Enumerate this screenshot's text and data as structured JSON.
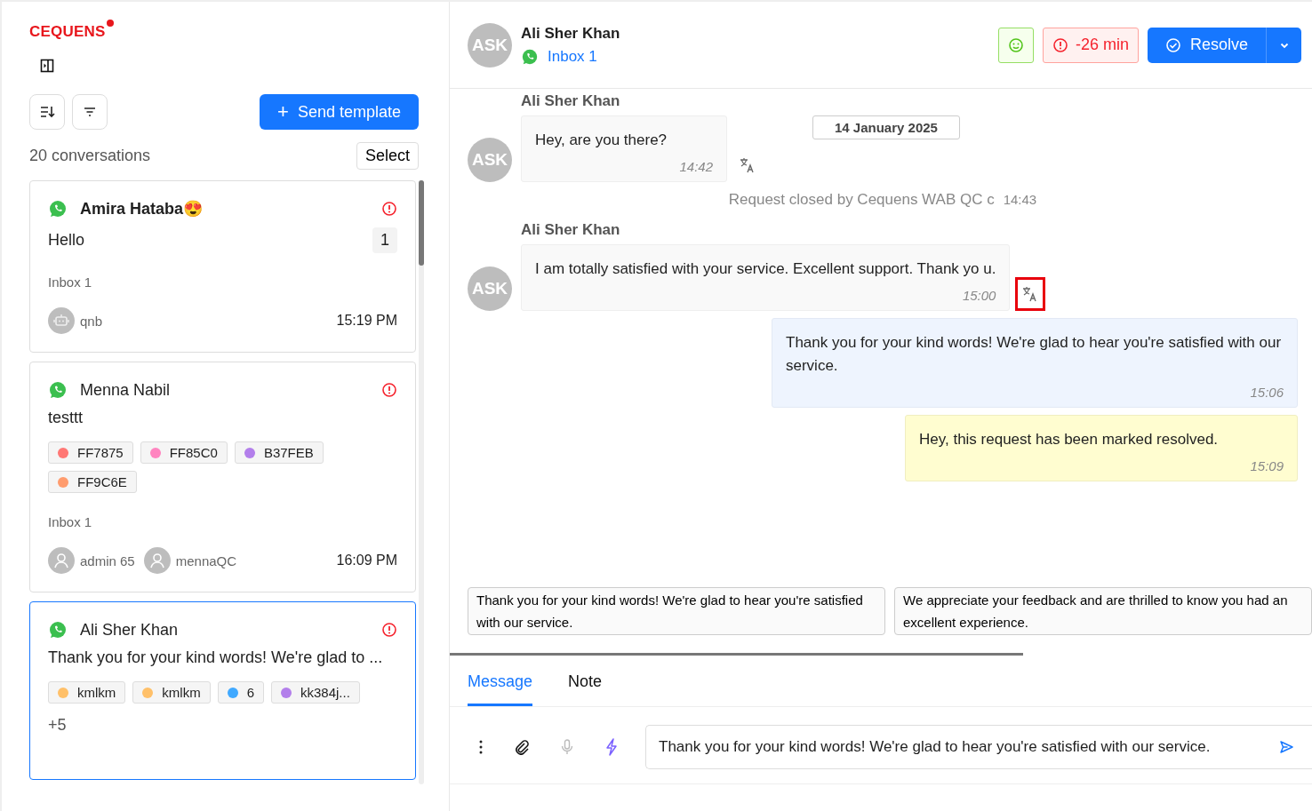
{
  "brand": {
    "logo": "CEQUENS"
  },
  "sidebar": {
    "send_template_icon": "+",
    "send_template": "Send template",
    "count": "20 conversations",
    "select": "Select",
    "conversations": [
      {
        "name": "Amira Hataba😍",
        "preview": "Hello",
        "unread": "1",
        "inbox": "Inbox 1",
        "agents": [
          {
            "name": "qnb",
            "kind": "bot"
          }
        ],
        "time": "15:19 PM",
        "selected": false
      },
      {
        "name": "Menna Nabil",
        "preview": "testtt",
        "tags": [
          {
            "label": "FF7875",
            "color": "#ff7875"
          },
          {
            "label": "FF85C0",
            "color": "#ff85c0"
          },
          {
            "label": "B37FEB",
            "color": "#b37feb"
          },
          {
            "label": "FF9C6E",
            "color": "#ff9c6e"
          }
        ],
        "inbox": "Inbox 1",
        "agents": [
          {
            "name": "admin 65",
            "kind": "user"
          },
          {
            "name": "mennaQC",
            "kind": "user"
          }
        ],
        "time": "16:09 PM",
        "selected": false
      },
      {
        "name": "Ali Sher Khan",
        "preview": "Thank you for your kind words! We're glad to ...",
        "tags": [
          {
            "label": "kmlkm",
            "color": "#ffc069"
          },
          {
            "label": "kmlkm",
            "color": "#ffc069"
          },
          {
            "label": "6",
            "color": "#40a9ff"
          },
          {
            "label": "kk384j...",
            "color": "#b37feb"
          }
        ],
        "more": "+5",
        "selected": true
      }
    ]
  },
  "chat": {
    "header": {
      "initials": "ASK",
      "name": "Ali Sher Khan",
      "inbox": "Inbox 1",
      "sla": "-26 min",
      "resolve": "Resolve"
    },
    "messages": [
      {
        "kind": "incoming",
        "sender": "Ali Sher Khan",
        "initials": "ASK",
        "text": "Hey, are you there?",
        "time": "14:42",
        "highlighted": false,
        "date": "14 January 2025"
      },
      {
        "kind": "event",
        "text": "Request closed by Cequens WAB QC c",
        "time": "14:43"
      },
      {
        "kind": "incoming",
        "sender": "Ali Sher Khan",
        "initials": "ASK",
        "text": "I am totally satisfied with your service. Excellent support. Thank yo u.",
        "time": "15:00",
        "highlighted": true
      },
      {
        "kind": "outgoing",
        "text": "Thank you for your kind words! We're glad to hear you're satisfied with our service.",
        "time": "15:06"
      },
      {
        "kind": "bot",
        "text": "Hey, this request has been marked resolved.",
        "time": "15:09"
      }
    ],
    "suggestions": [
      "Thank you for your kind words! We're glad to hear you're satisfied with our service.",
      "We appreciate your feedback and are thrilled to know you had an excellent experience."
    ],
    "tabs": [
      {
        "label": "Message",
        "selected": true
      },
      {
        "label": "Note",
        "selected": false
      }
    ],
    "composer": {
      "value": "Thank you for your kind words! We're glad to hear you're satisfied with our service."
    }
  }
}
